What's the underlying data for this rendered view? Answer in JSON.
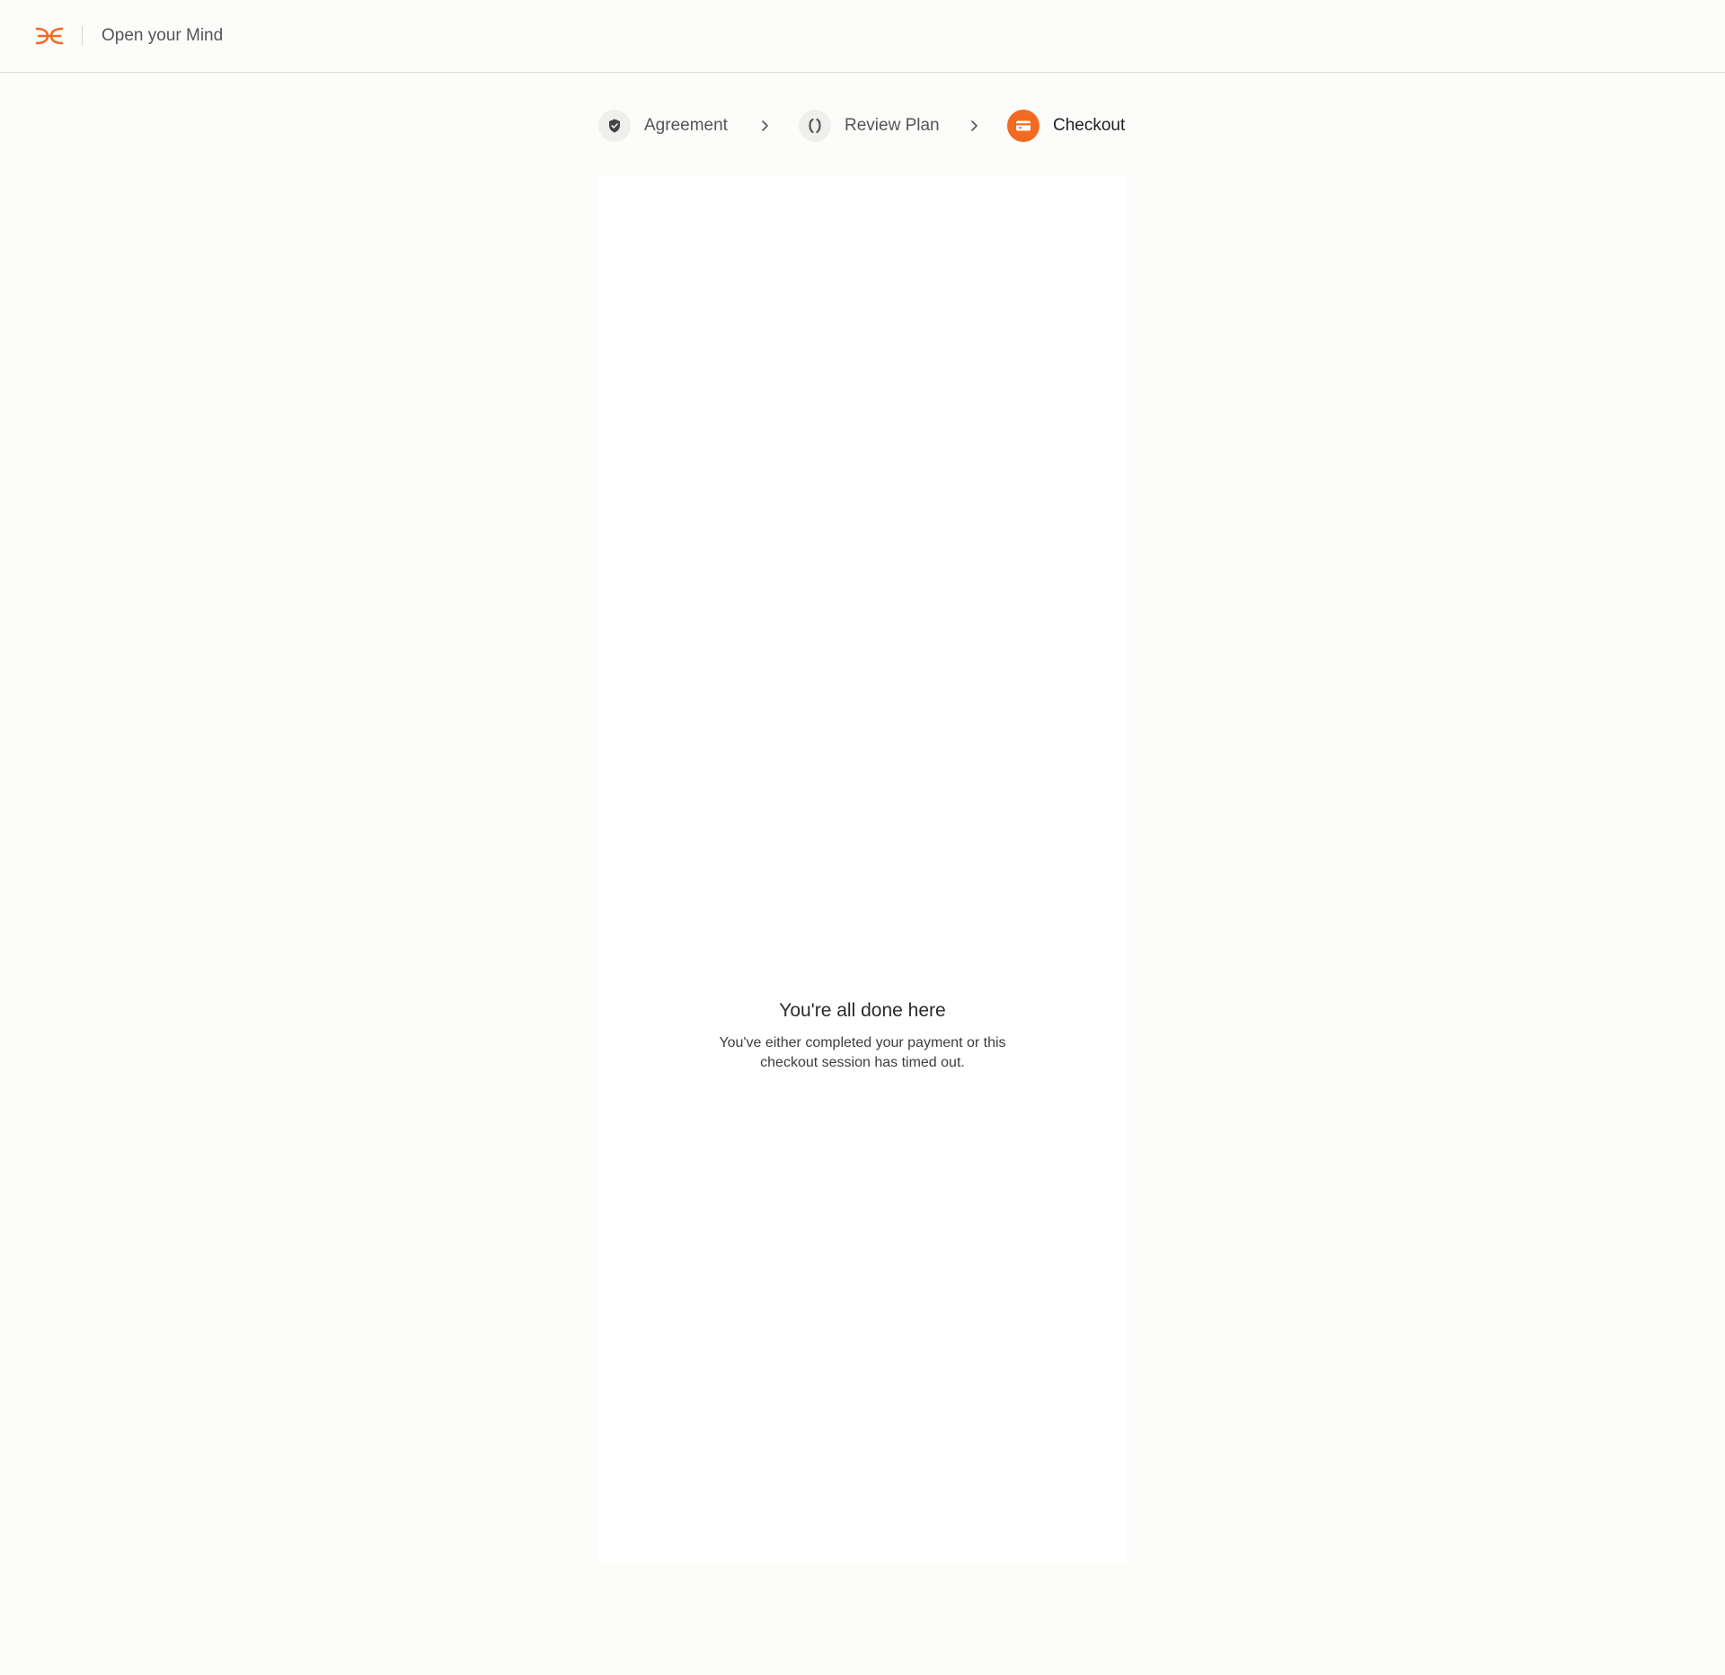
{
  "header": {
    "brand_name": "Open your Mind",
    "brand_color": "#f36a21"
  },
  "stepper": {
    "steps": [
      {
        "label": "Agreement",
        "icon": "shield-check-icon",
        "state": "completed"
      },
      {
        "label": "Review Plan",
        "icon": "laurel-icon",
        "state": "completed"
      },
      {
        "label": "Checkout",
        "icon": "credit-card-icon",
        "state": "active"
      }
    ],
    "active_color": "#f36a21"
  },
  "checkout": {
    "title": "You're all done here",
    "message": "You've either completed your payment or this checkout session has timed out."
  }
}
